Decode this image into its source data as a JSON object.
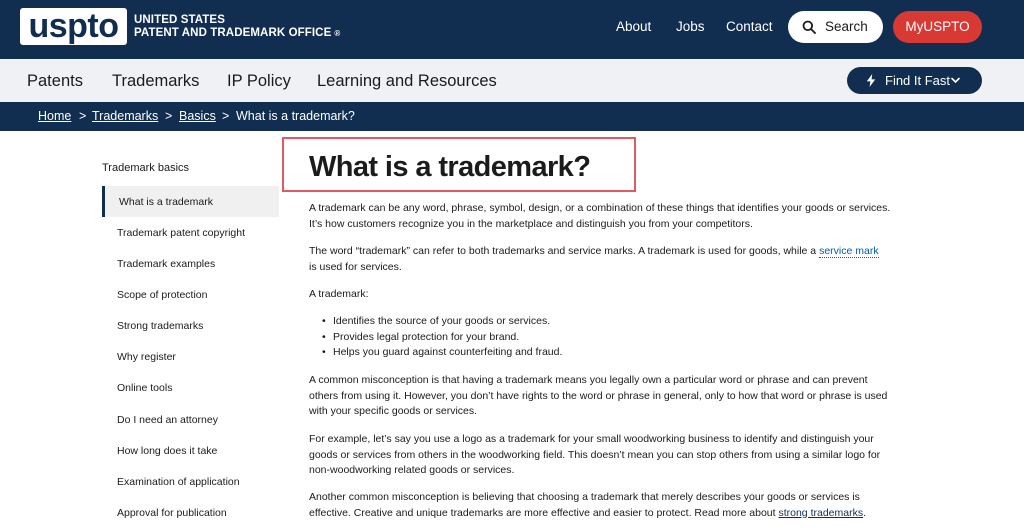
{
  "header": {
    "logo_text": "uspto",
    "org_line1": "UNITED STATES",
    "org_line2": "PATENT AND TRADEMARK OFFICE",
    "org_reg": "®",
    "links": [
      "About",
      "Jobs",
      "Contact"
    ],
    "search_label": "Search",
    "myuspto_label": "MyUSPTO"
  },
  "nav": {
    "items": [
      "Patents",
      "Trademarks",
      "IP Policy",
      "Learning and Resources"
    ],
    "find_label": "Find It Fast"
  },
  "breadcrumb": {
    "items": [
      "Home",
      "Trademarks",
      "Basics"
    ],
    "separator": ">",
    "current": "What is a trademark?"
  },
  "sidebar": {
    "title": "Trademark basics",
    "items": [
      "What is a trademark",
      "Trademark patent copyright",
      "Trademark examples",
      "Scope of protection",
      "Strong trademarks",
      "Why register",
      "Online tools",
      "Do I need an attorney",
      "How long does it take",
      "Examination of application",
      "Approval for publication"
    ]
  },
  "main": {
    "title": "What is a trademark?",
    "p1_line1": "A trademark can be any word, phrase, symbol, design, or a combination of these things that identifies your goods or services.",
    "p1_line2": "It’s how customers recognize you in the marketplace and distinguish you from your competitors.",
    "p2_line1": "The word “trademark” can refer to both trademarks and service marks. A trademark is used for goods, while a ",
    "p2_link": "service mark",
    "p2_line2": "is used for services.",
    "p3": "A trademark:",
    "bullets": [
      "Identifies the source of your goods or services.",
      "Provides legal protection for your brand.",
      "Helps you guard against counterfeiting and fraud."
    ],
    "p4_line1": "A common misconception is that having a trademark means you legally own a particular word or phrase and can prevent",
    "p4_line2": "others from using it. However, you don’t have rights to the word or phrase in general, only to how that word or phrase is used",
    "p4_line3": "with your specific goods or services.",
    "p5_line1": "For example, let’s say you use a logo as a trademark for your small woodworking business to identify and distinguish your",
    "p5_line2": "goods or services from others in the woodworking field. This doesn’t mean you can stop others from using a similar logo for",
    "p5_line3": "non-woodworking related goods or services.",
    "p6_line1": "Another common misconception is believing that choosing a trademark that merely describes your goods or services is",
    "p6_line2_pre": "effective. Creative and unique trademarks are more effective and easier to protect. Read more about ",
    "p6_link": "strong trademarks",
    "p6_line2_post": "."
  },
  "colors": {
    "navy": "#112e51",
    "red": "#d83933",
    "highlight_box": "#e05a5f"
  }
}
